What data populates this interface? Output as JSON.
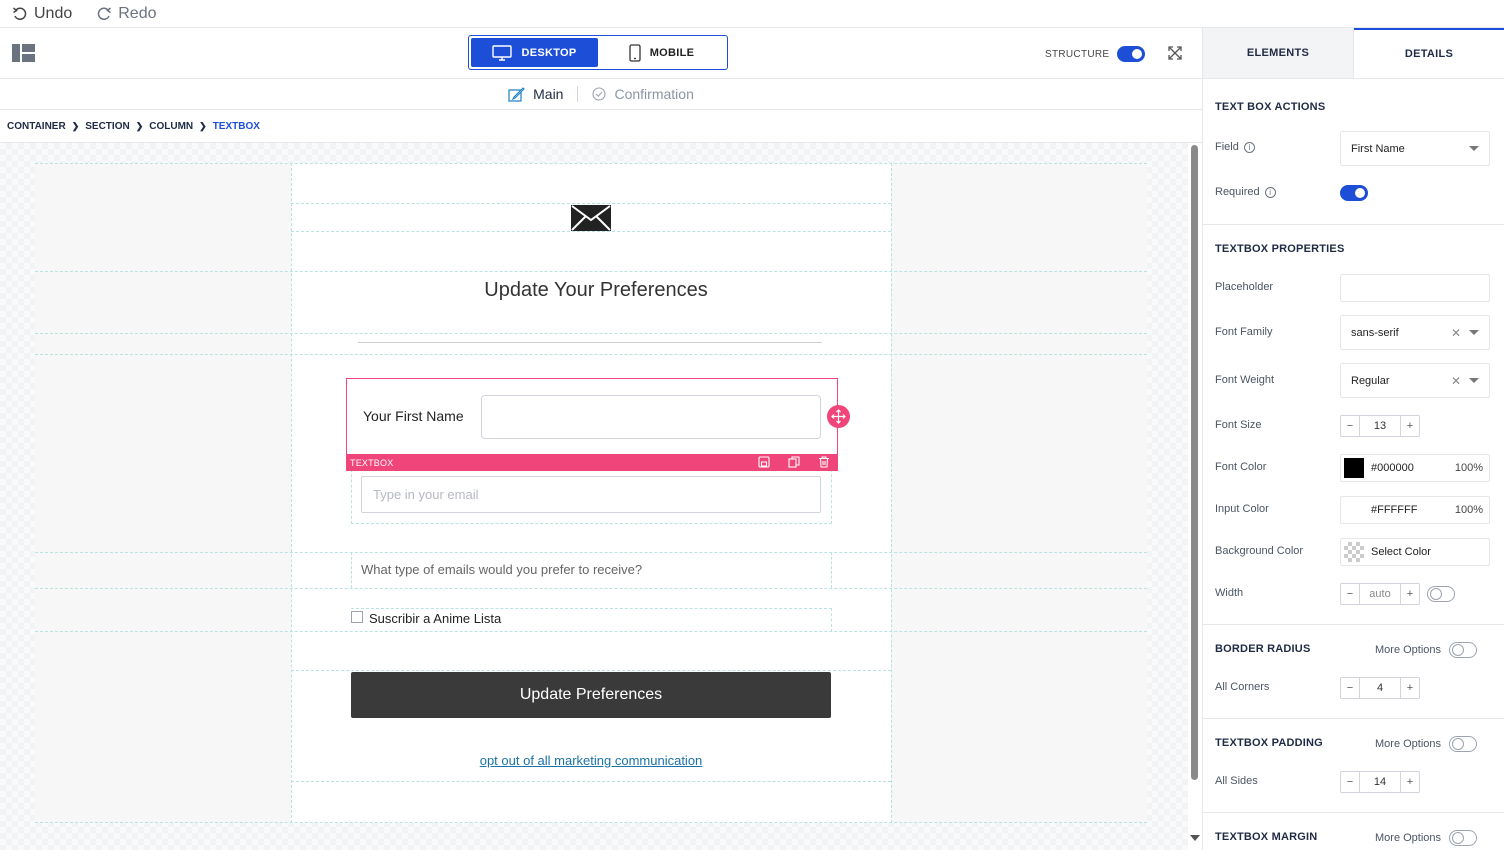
{
  "history": {
    "undo": "Undo",
    "redo": "Redo"
  },
  "toolbar": {
    "desktop": "DESKTOP",
    "mobile": "MOBILE",
    "structure": "STRUCTURE",
    "structure_on": true
  },
  "pages": [
    {
      "label": "Main",
      "active": true
    },
    {
      "label": "Confirmation",
      "active": false
    }
  ],
  "breadcrumb": [
    "CONTAINER",
    "SECTION",
    "COLUMN",
    "TEXTBOX"
  ],
  "email": {
    "headline": "Update Your Preferences",
    "first_name_label": "Your First Name",
    "email_placeholder": "Type in your email",
    "selected_tag": "TEXTBOX",
    "question": "What type of emails would you prefer to receive?",
    "checkbox_label": "Suscribir a Anime Lista",
    "button_label": "Update Preferences",
    "optout_link": "opt out of all marketing communication"
  },
  "panel": {
    "tabs": [
      "ELEMENTS",
      "DETAILS"
    ],
    "active_tab": "DETAILS",
    "actions": {
      "title": "TEXT BOX ACTIONS",
      "field_label": "Field",
      "field_value": "First Name",
      "required_label": "Required",
      "required": true
    },
    "properties": {
      "title": "TEXTBOX PROPERTIES",
      "placeholder_label": "Placeholder",
      "placeholder_value": "",
      "font_family_label": "Font Family",
      "font_family_value": "sans-serif",
      "font_weight_label": "Font Weight",
      "font_weight_value": "Regular",
      "font_size_label": "Font Size",
      "font_size_value": "13",
      "font_color_label": "Font Color",
      "font_color_hex": "#000000",
      "font_color_opacity": "100%",
      "input_color_label": "Input Color",
      "input_color_hex": "#FFFFFF",
      "input_color_opacity": "100%",
      "bg_color_label": "Background Color",
      "bg_color_value": "Select Color",
      "width_label": "Width",
      "width_value": "auto"
    },
    "border_radius": {
      "title": "BORDER RADIUS",
      "more": "More Options",
      "corners_label": "All Corners",
      "corners_value": "4"
    },
    "padding": {
      "title": "TEXTBOX PADDING",
      "more": "More Options",
      "sides_label": "All Sides",
      "sides_value": "14"
    },
    "margin": {
      "title": "TEXTBOX MARGIN",
      "more": "More Options"
    }
  },
  "colors": {
    "accent": "#1d4ed8",
    "selection": "#f0457a",
    "button": "#3a3a3a",
    "link": "#1a73a8"
  }
}
